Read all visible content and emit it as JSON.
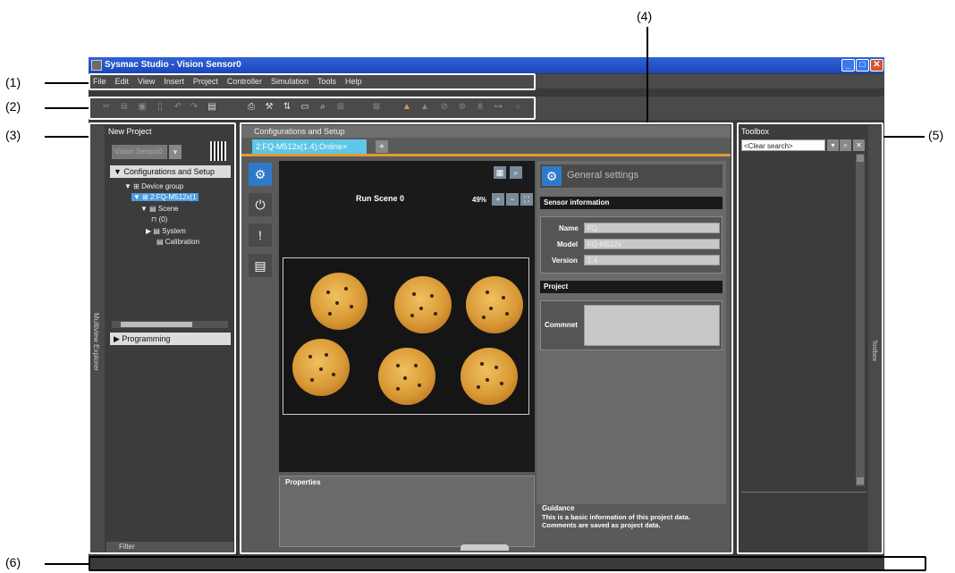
{
  "callouts": {
    "c1": "(1)",
    "c2": "(2)",
    "c3": "(3)",
    "c4": "(4)",
    "c5": "(5)",
    "c6": "(6)"
  },
  "window": {
    "title": "Sysmac Studio - Vision Sensor0"
  },
  "menu": [
    "File",
    "Edit",
    "View",
    "Insert",
    "Project",
    "Controller",
    "Simulation",
    "Tools",
    "Help"
  ],
  "explorer": {
    "tab_label": "Multiview Explorer",
    "header": "New Project",
    "device_select": "Vision Sensor0",
    "configurations": "▼ Configurations and Setup",
    "tree": {
      "device_group": "▼ ⊞ Device group",
      "device": "▼ ⊞ 2:FQ-M512x(1",
      "scene": "▼ ▤ Scene",
      "scene_item": "⊓ (0)",
      "system": "▶ ▤ System",
      "calibration": "▤ Calibration"
    },
    "programming": "▶ Programming",
    "filter": "Filter"
  },
  "config_panel": {
    "title": "Configurations and Setup",
    "tab": "2:FQ-M512x(1.4):Online×",
    "run_scene": "Run Scene 0",
    "zoom": "49%",
    "properties_label": "Properties",
    "general_settings": "General settings",
    "sensor_information": "Sensor information",
    "name_label": "Name",
    "name_value": "FQ",
    "model_label": "Model",
    "model_value": "FQ-M512x",
    "version_label": "Version",
    "version_value": "1.4",
    "project_label": "Project",
    "comment_label": "Commnet",
    "guidance_title": "Guidance",
    "guidance_text": "This is a basic information of this project data. Comments are saved as project data."
  },
  "toolbox": {
    "header": "Toolbox",
    "search_placeholder": "<Clear search>",
    "side_tab": "Toolbox"
  },
  "colors": {
    "accent": "#2f7ac8",
    "tab_active": "#5ec6e8",
    "orange_bar": "#e39a2e",
    "window_title": "#2f63d6"
  }
}
